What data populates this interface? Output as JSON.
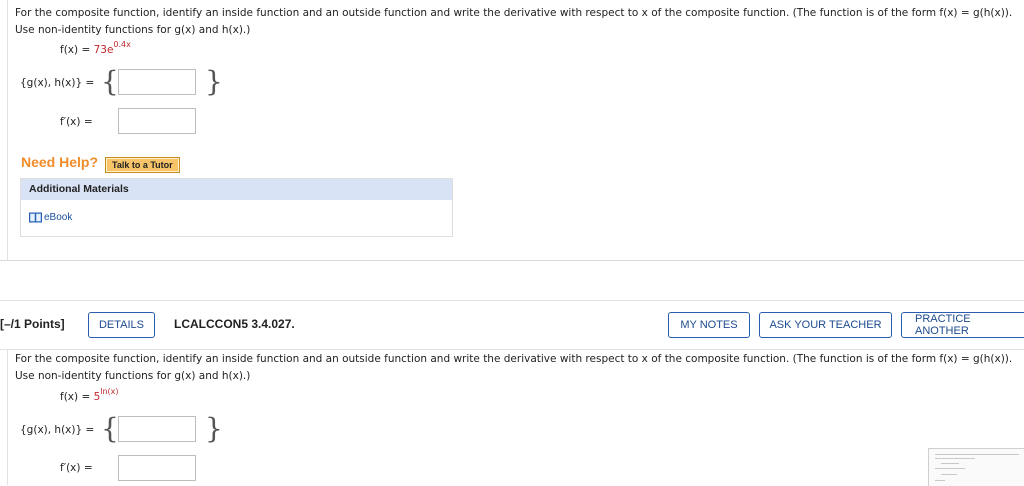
{
  "question1": {
    "prompt_line1": "For the composite function, identify an inside function and an outside function and write the derivative with respect to x of the composite function. (The function is of the form  f(x) = g(h(x)).",
    "prompt_line2": "Use non-identity functions for g(x) and h(x).)",
    "function_label": "f(x) = ",
    "function_base": "73e",
    "function_exponent": "0.4x",
    "gh_label": "{g(x), h(x)}  =",
    "brace_open": "{",
    "brace_close": "}",
    "derivative_label": "f′(x)  ="
  },
  "help": {
    "need_help": "Need Help?",
    "tutor_button": "Talk to a Tutor"
  },
  "additional_materials": {
    "heading": "Additional Materials",
    "ebook_link": "eBook"
  },
  "question2": {
    "points": "[–/1 Points]",
    "details_button": "DETAILS",
    "code": "LCALCCON5 3.4.027.",
    "my_notes_button": "MY NOTES",
    "ask_teacher_button": "ASK YOUR TEACHER",
    "practice_button": "PRACTICE ANOTHER",
    "prompt_line1": "For the composite function, identify an inside function and an outside function and write the derivative with respect to x of the composite function. (The function is of the form  f(x) = g(h(x)).",
    "prompt_line2": "Use non-identity functions for g(x) and h(x).)",
    "function_label": "f(x) = ",
    "function_base": "5",
    "function_exponent": "ln(x)",
    "gh_label": "{g(x), h(x)}  =",
    "brace_open": "{",
    "brace_close": "}",
    "derivative_label": "f′(x)  ="
  },
  "colors": {
    "accent_red": "#c0282d",
    "need_help_orange": "#f08d2a",
    "button_blue": "#2a5db0",
    "materials_header": "#d9e3f6"
  }
}
